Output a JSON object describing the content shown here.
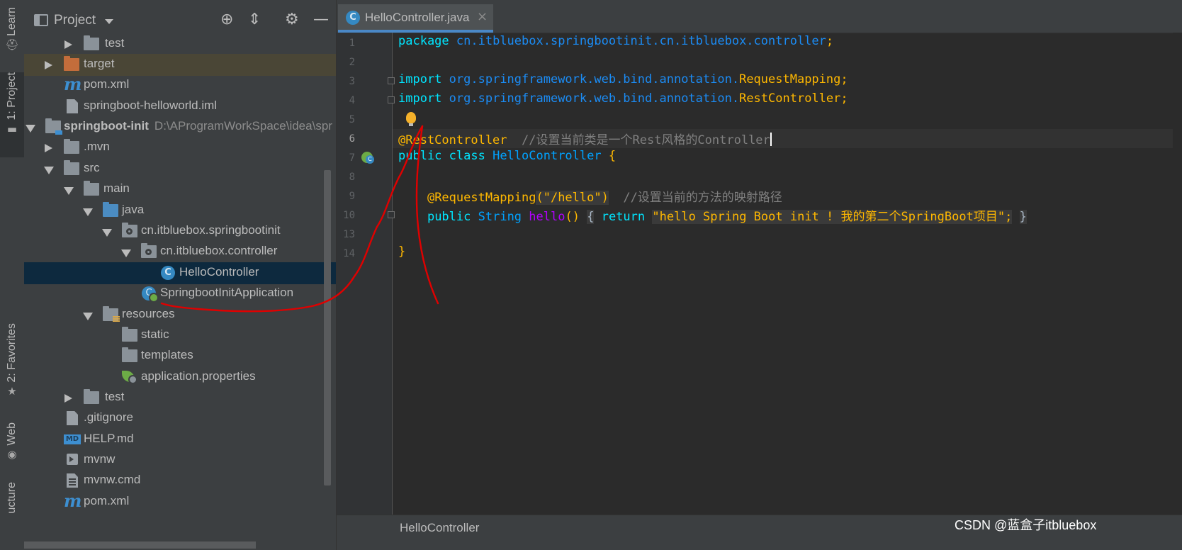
{
  "left_strip": {
    "learn": "Learn",
    "project": "1: Project",
    "favorites": "2: Favorites",
    "web": "Web",
    "structure": "ucture"
  },
  "project_panel": {
    "title": "Project",
    "tree": [
      {
        "label": "test"
      },
      {
        "label": "target"
      },
      {
        "label": "pom.xml"
      },
      {
        "label": "springboot-helloworld.iml"
      },
      {
        "label": "springboot-init",
        "path": "D:\\AProgramWorkSpace\\idea\\spr"
      },
      {
        "label": ".mvn"
      },
      {
        "label": "src"
      },
      {
        "label": "main"
      },
      {
        "label": "java"
      },
      {
        "label": "cn.itbluebox.springbootinit"
      },
      {
        "label": "cn.itbluebox.controller"
      },
      {
        "label": "HelloController"
      },
      {
        "label": "SpringbootInitApplication"
      },
      {
        "label": "resources"
      },
      {
        "label": "static"
      },
      {
        "label": "templates"
      },
      {
        "label": "application.properties"
      },
      {
        "label": "test"
      },
      {
        "label": ".gitignore"
      },
      {
        "label": "HELP.md"
      },
      {
        "label": "mvnw"
      },
      {
        "label": "mvnw.cmd"
      },
      {
        "label": "pom.xml"
      }
    ],
    "md_badge": "MD",
    "class_glyph": "C"
  },
  "editor": {
    "tab_label": "HelloController.java",
    "tab_close": "×",
    "line_numbers": [
      "1",
      "2",
      "3",
      "4",
      "5",
      "6",
      "7",
      "8",
      "9",
      "10",
      "13",
      "14"
    ],
    "code": {
      "l1_kw": "package",
      "l1_pkg": "cn.itbluebox.springbootinit.cn.itbluebox.controller",
      "semi": ";",
      "l3_kw": "import",
      "l3_pkg": "org.springframework.web.bind.annotation.",
      "l3_cls": "RequestMapping",
      "l4_kw": "import",
      "l4_pkg": "org.springframework.web.bind.annotation.",
      "l4_cls": "RestController",
      "l6_ann": "@RestController",
      "l6_cmt": "//设置当前类是一个Rest风格的Controller",
      "l7_kw": "public class",
      "l7_cls": "HelloController",
      "l7_brace": "{",
      "l9_ann": "@RequestMapping",
      "l9_arg": "(\"/hello\")",
      "l9_cmt": "//设置当前的方法的映射路径",
      "l10_kw": "public",
      "l10_type": "String",
      "l10_meth": "hello",
      "l10_paren": "()",
      "l10_open": "{",
      "l10_ret": "return",
      "l10_str": "\"hello Spring Boot init ! 我的第二个SpringBoot项目\"",
      "l10_close": "}",
      "l14_brace": "}"
    },
    "breadcrumb": "HelloController",
    "watermark": "CSDN @蓝盒子itbluebox"
  },
  "colors": {
    "annotation_red": "#e00000",
    "keyword": "#00e5ff",
    "package": "#1b8cf5",
    "string": "#ffb800",
    "selection": "#0d293e"
  }
}
